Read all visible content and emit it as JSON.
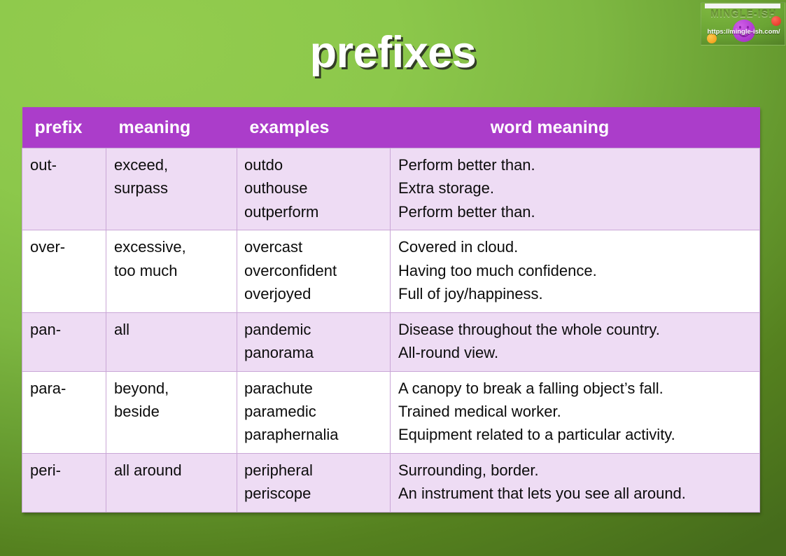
{
  "slide": {
    "title": "prefixes",
    "background_start_color": "#8cc84b",
    "background_end_color": "#456b1b"
  },
  "logo": {
    "brand": "MINGLE-ISH",
    "url": "https://mingle-ish.com/",
    "smiley_color": "#b43fd4",
    "red_dot_color": "#e8402e",
    "orange_dot_color": "#f5a623"
  },
  "table": {
    "header_color": "#ab3dca",
    "tint_row_color": "#eedcf4",
    "border_color": "#c9a6d6",
    "headers": {
      "prefix": "prefix",
      "meaning": "meaning",
      "examples": "examples",
      "word_meaning": "word meaning"
    },
    "rows": [
      {
        "prefix": "out-",
        "meaning": [
          "exceed,",
          "surpass"
        ],
        "examples": [
          "outdo",
          "outhouse",
          "outperform"
        ],
        "word_meaning": [
          "Perform better than.",
          "Extra storage.",
          "Perform better than."
        ],
        "shade": "tint"
      },
      {
        "prefix": "over-",
        "meaning": [
          "excessive,",
          "too much"
        ],
        "examples": [
          "overcast",
          "overconfident",
          "overjoyed"
        ],
        "word_meaning": [
          "Covered in cloud.",
          "Having too much confidence.",
          "Full of joy/happiness."
        ],
        "shade": "plain"
      },
      {
        "prefix": "pan-",
        "meaning": [
          "all"
        ],
        "examples": [
          "pandemic",
          "panorama"
        ],
        "word_meaning": [
          "Disease throughout the whole country.",
          "All-round view."
        ],
        "shade": "tint"
      },
      {
        "prefix": "para-",
        "meaning": [
          "beyond,",
          "beside"
        ],
        "examples": [
          "parachute",
          "paramedic",
          "paraphernalia"
        ],
        "word_meaning": [
          "A canopy to break a falling object’s fall.",
          "Trained medical worker.",
          "Equipment related to a particular activity."
        ],
        "shade": "plain"
      },
      {
        "prefix": "peri-",
        "meaning": [
          "all around"
        ],
        "examples": [
          "peripheral",
          "periscope"
        ],
        "word_meaning": [
          "Surrounding, border.",
          "An instrument that lets you see all around."
        ],
        "shade": "tint"
      }
    ]
  }
}
